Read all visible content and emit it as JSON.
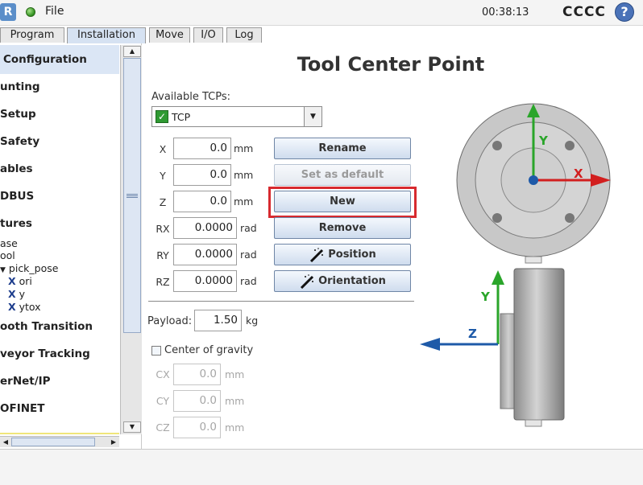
{
  "topbar": {
    "logo_text": "R",
    "file_menu": "File",
    "clock": "00:38:13",
    "robot_name": "CCCC",
    "help": "?"
  },
  "tabs": [
    "Program",
    "Installation",
    "Move",
    "I/O",
    "Log"
  ],
  "active_tab": "Installation",
  "sidebar": {
    "items": [
      {
        "label": "Configuration",
        "selected": true
      },
      {
        "label": "unting"
      },
      {
        "label": "Setup"
      },
      {
        "label": "Safety"
      },
      {
        "label": "ables"
      },
      {
        "label": "DBUS"
      },
      {
        "label": "tures"
      }
    ],
    "features": {
      "base": "ase",
      "tool": "ool",
      "pick_pose": "pick_pose",
      "children": [
        "ori",
        "y",
        "ytox"
      ],
      "x_icon": "X"
    },
    "more_items": [
      {
        "label": "ooth Transition"
      },
      {
        "label": "veyor Tracking"
      },
      {
        "label": "erNet/IP"
      },
      {
        "label": "OFINET"
      }
    ]
  },
  "main": {
    "title": "Tool Center Point",
    "available_label": "Available TCPs:",
    "selected_tcp": "TCP",
    "coords": [
      {
        "label": "X",
        "value": "0.0",
        "unit": "mm"
      },
      {
        "label": "Y",
        "value": "0.0",
        "unit": "mm"
      },
      {
        "label": "Z",
        "value": "0.0",
        "unit": "mm"
      },
      {
        "label": "RX",
        "value": "0.0000",
        "unit": "rad"
      },
      {
        "label": "RY",
        "value": "0.0000",
        "unit": "rad"
      },
      {
        "label": "RZ",
        "value": "0.0000",
        "unit": "rad"
      }
    ],
    "buttons": {
      "rename": "Rename",
      "set_default": "Set as default",
      "new": "New",
      "remove": "Remove",
      "position": "Position",
      "orientation": "Orientation"
    },
    "payload": {
      "label": "Payload:",
      "value": "1.50",
      "unit": "kg"
    },
    "cog": {
      "label": "Center of gravity",
      "checked": false,
      "fields": [
        {
          "label": "CX",
          "value": "0.0",
          "unit": "mm"
        },
        {
          "label": "CY",
          "value": "0.0",
          "unit": "mm"
        },
        {
          "label": "CZ",
          "value": "0.0",
          "unit": "mm"
        }
      ]
    }
  },
  "diagram": {
    "axis_y": "Y",
    "axis_x": "X",
    "axis_z": "Z",
    "axis_y2": "Y",
    "colors": {
      "x": "#d21f1f",
      "y": "#2aa52a",
      "z": "#1e5aa8"
    }
  }
}
